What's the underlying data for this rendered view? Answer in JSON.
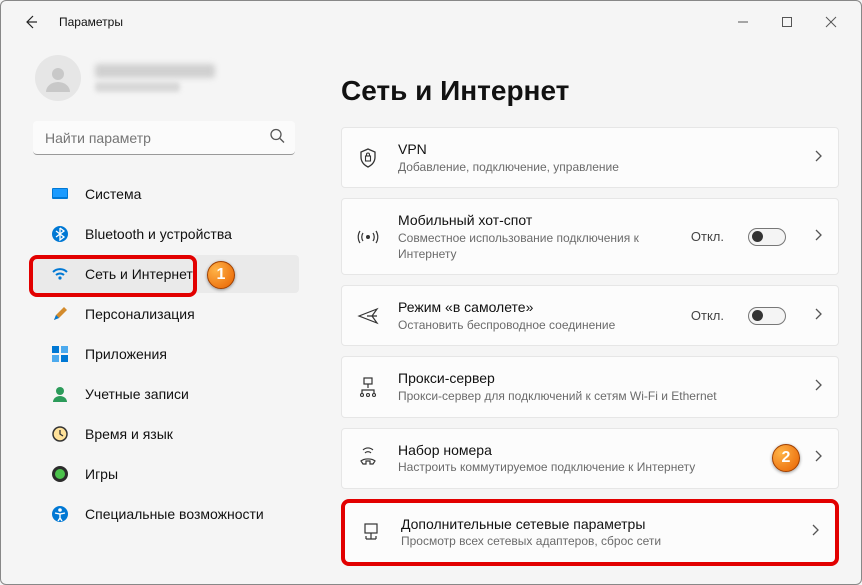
{
  "header": {
    "title": "Параметры"
  },
  "search": {
    "placeholder": "Найти параметр"
  },
  "nav": {
    "items": [
      {
        "id": "system",
        "label": "Система"
      },
      {
        "id": "bluetooth",
        "label": "Bluetooth и устройства"
      },
      {
        "id": "network",
        "label": "Сеть и Интернет"
      },
      {
        "id": "personalization",
        "label": "Персонализация"
      },
      {
        "id": "apps",
        "label": "Приложения"
      },
      {
        "id": "accounts",
        "label": "Учетные записи"
      },
      {
        "id": "time",
        "label": "Время и язык"
      },
      {
        "id": "gaming",
        "label": "Игры"
      },
      {
        "id": "accessibility",
        "label": "Специальные возможности"
      }
    ],
    "selectedIndex": 2
  },
  "page": {
    "title": "Сеть и Интернет"
  },
  "statuses": {
    "off": "Откл."
  },
  "annotations": {
    "step1": "1",
    "step2": "2"
  },
  "cards": [
    {
      "id": "vpn",
      "title": "VPN",
      "sub": "Добавление, подключение, управление",
      "hasToggle": false
    },
    {
      "id": "hotspot",
      "title": "Мобильный хот-спот",
      "sub": "Совместное использование подключения к Интернету",
      "hasToggle": true
    },
    {
      "id": "airplane",
      "title": "Режим «в самолете»",
      "sub": "Остановить беспроводное соединение",
      "hasToggle": true
    },
    {
      "id": "proxy",
      "title": "Прокси-сервер",
      "sub": "Прокси-сервер для подключений к сетям Wi-Fi и Ethernet",
      "hasToggle": false
    },
    {
      "id": "dialup",
      "title": "Набор номера",
      "sub": "Настроить коммутируемое подключение к Интернету",
      "hasToggle": false
    },
    {
      "id": "advanced",
      "title": "Дополнительные сетевые параметры",
      "sub": "Просмотр всех сетевых адаптеров, сброс сети",
      "hasToggle": false
    }
  ]
}
